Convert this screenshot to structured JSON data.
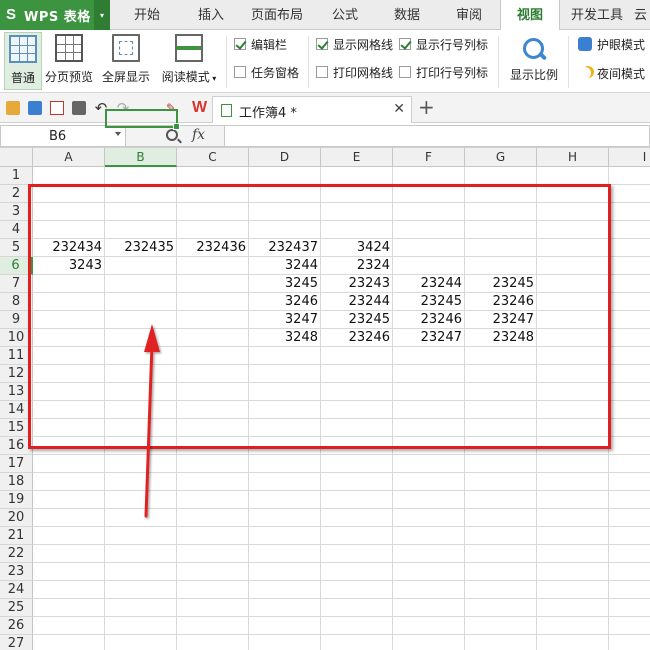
{
  "app": {
    "title": "WPS 表格"
  },
  "menu": {
    "tabs": [
      {
        "label": "开始"
      },
      {
        "label": "插入"
      },
      {
        "label": "页面布局"
      },
      {
        "label": "公式"
      },
      {
        "label": "数据"
      },
      {
        "label": "审阅"
      },
      {
        "label": "视图"
      },
      {
        "label": "开发工具"
      },
      {
        "label": "云"
      }
    ],
    "active": "视图"
  },
  "ribbon": {
    "normal": "普通",
    "page_break": "分页预览",
    "fullscreen": "全屏显示",
    "reading_mode": "阅读模式",
    "edit_bar": "编辑栏",
    "task_pane": "任务窗格",
    "show_gridlines": "显示网格线",
    "print_gridlines": "打印网格线",
    "show_headings": "显示行号列标",
    "print_headings": "打印行号列标",
    "zoom": "显示比例",
    "eye_mode": "护眼模式",
    "night_mode": "夜间模式",
    "checked": {
      "edit_bar": true,
      "task_pane": false,
      "show_gridlines": true,
      "print_gridlines": false,
      "show_headings": true,
      "print_headings": false
    }
  },
  "document": {
    "tab_title": "工作簿4 *"
  },
  "formula_bar": {
    "cell_ref": "B6",
    "fx": "fx",
    "value": ""
  },
  "sheet": {
    "columns": [
      "A",
      "B",
      "C",
      "D",
      "E",
      "F",
      "G",
      "H",
      "I"
    ],
    "rows": [
      "1",
      "2",
      "3",
      "4",
      "5",
      "6",
      "7",
      "8",
      "9",
      "10",
      "11",
      "12",
      "13",
      "14",
      "15",
      "16",
      "17",
      "18",
      "19",
      "20",
      "21",
      "22",
      "23",
      "24",
      "25",
      "26",
      "27"
    ],
    "selected_col": "B",
    "selected_row": "6",
    "cells": [
      {
        "ref": "A5",
        "value": "232434"
      },
      {
        "ref": "B5",
        "value": "232435"
      },
      {
        "ref": "C5",
        "value": "232436"
      },
      {
        "ref": "D5",
        "value": "232437"
      },
      {
        "ref": "E5",
        "value": "3424"
      },
      {
        "ref": "A6",
        "value": "3243"
      },
      {
        "ref": "D6",
        "value": "3244"
      },
      {
        "ref": "E6",
        "value": "2324"
      },
      {
        "ref": "D7",
        "value": "3245"
      },
      {
        "ref": "E7",
        "value": "23243"
      },
      {
        "ref": "F7",
        "value": "23244"
      },
      {
        "ref": "G7",
        "value": "23245"
      },
      {
        "ref": "D8",
        "value": "3246"
      },
      {
        "ref": "E8",
        "value": "23244"
      },
      {
        "ref": "F8",
        "value": "23245"
      },
      {
        "ref": "G8",
        "value": "23246"
      },
      {
        "ref": "D9",
        "value": "3247"
      },
      {
        "ref": "E9",
        "value": "23245"
      },
      {
        "ref": "F9",
        "value": "23246"
      },
      {
        "ref": "G9",
        "value": "23247"
      },
      {
        "ref": "D10",
        "value": "3248"
      },
      {
        "ref": "E10",
        "value": "23246"
      },
      {
        "ref": "F10",
        "value": "23247"
      },
      {
        "ref": "G10",
        "value": "23248"
      }
    ]
  },
  "colors": {
    "accent": "#3d9440",
    "annotation": "#e02020"
  }
}
